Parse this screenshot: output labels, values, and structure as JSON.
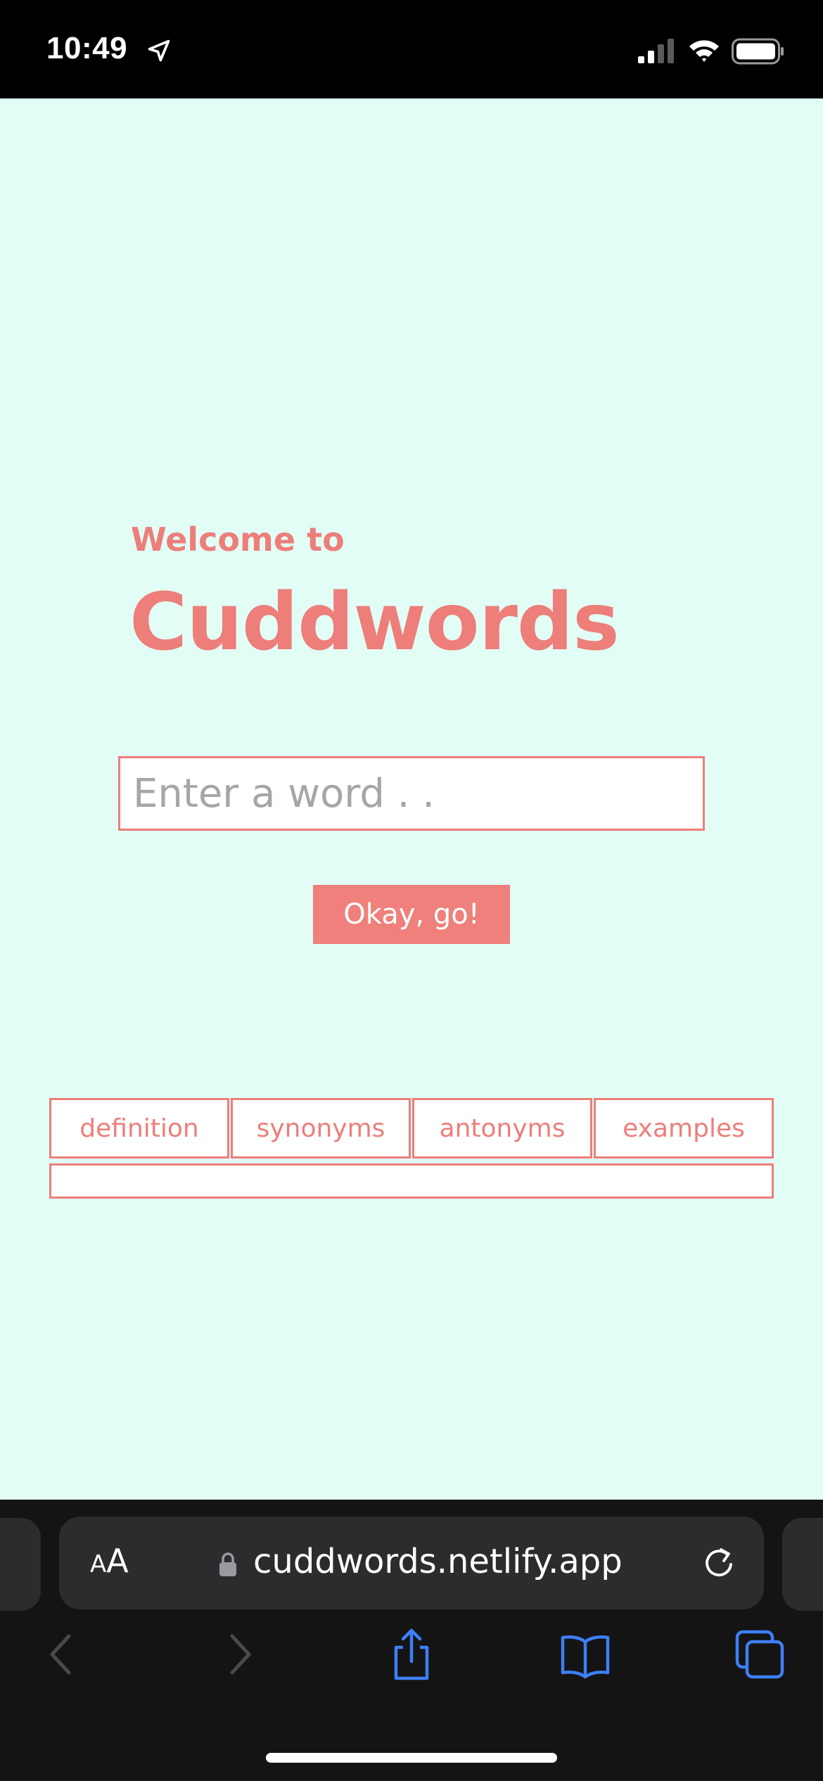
{
  "status_bar": {
    "time": "10:49",
    "icons": [
      "location-arrow-icon",
      "signal-icon",
      "wifi-icon",
      "battery-icon"
    ]
  },
  "hero": {
    "welcome": "Welcome to",
    "title": "Cuddwords"
  },
  "search": {
    "placeholder": "Enter a word . .",
    "value": "",
    "button_label": "Okay, go!"
  },
  "tabs": [
    {
      "label": "definition"
    },
    {
      "label": "synonyms"
    },
    {
      "label": "antonyms"
    },
    {
      "label": "examples"
    }
  ],
  "browser": {
    "text_size_label_small": "A",
    "text_size_label_big": "A",
    "url": "cuddwords.netlify.app",
    "nav_icons": [
      "back-icon",
      "forward-icon",
      "share-icon",
      "bookmarks-icon",
      "tabs-icon"
    ]
  },
  "colors": {
    "accent": "#ed7e7a",
    "background": "#e2fdf6",
    "safari_blue": "#3d7ff6"
  }
}
